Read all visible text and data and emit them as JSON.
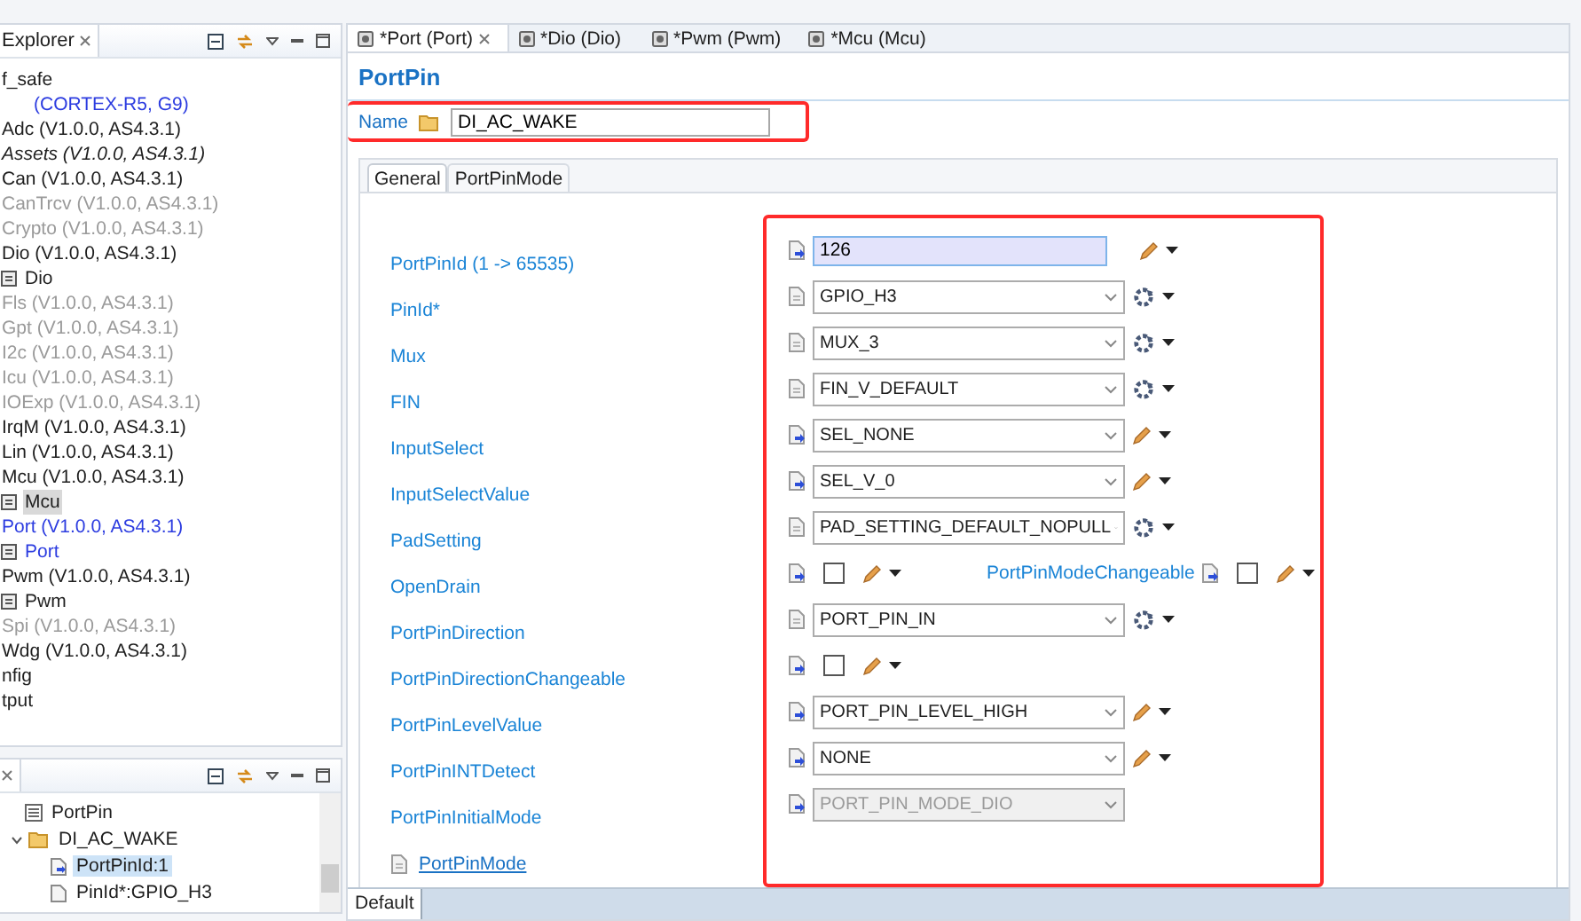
{
  "explorer": {
    "title": "Explorer",
    "items": [
      {
        "label": "f_safe",
        "kind": "module",
        "disabled": false,
        "italic": false,
        "color": "#1e1e1e",
        "selected": false
      },
      {
        "label": "(CORTEX-R5, G9)",
        "kind": "module",
        "disabled": false,
        "italic": false,
        "color": "#2c3ce0",
        "selected": false
      },
      {
        "label": "Adc (V1.0.0, AS4.3.1)",
        "kind": "module",
        "disabled": false,
        "italic": false,
        "color": "#1e1e1e",
        "selected": false
      },
      {
        "label": "Assets (V1.0.0, AS4.3.1)",
        "kind": "module",
        "disabled": false,
        "italic": true,
        "color": "#1e1e1e",
        "selected": false
      },
      {
        "label": "Can (V1.0.0, AS4.3.1)",
        "kind": "module",
        "disabled": false,
        "italic": false,
        "color": "#1e1e1e",
        "selected": false
      },
      {
        "label": "CanTrcv (V1.0.0, AS4.3.1)",
        "kind": "module",
        "disabled": true,
        "italic": false,
        "selected": false
      },
      {
        "label": "Crypto (V1.0.0, AS4.3.1)",
        "kind": "module",
        "disabled": true,
        "italic": false,
        "selected": false
      },
      {
        "label": "Dio (V1.0.0, AS4.3.1)",
        "kind": "module",
        "disabled": false,
        "italic": false,
        "color": "#1e1e1e",
        "selected": false
      },
      {
        "label": "Dio",
        "kind": "config",
        "disabled": false,
        "italic": false,
        "color": "#1e1e1e",
        "selected": false
      },
      {
        "label": "Fls (V1.0.0, AS4.3.1)",
        "kind": "module",
        "disabled": true,
        "italic": false,
        "selected": false
      },
      {
        "label": "Gpt (V1.0.0, AS4.3.1)",
        "kind": "module",
        "disabled": true,
        "italic": false,
        "selected": false
      },
      {
        "label": "I2c (V1.0.0, AS4.3.1)",
        "kind": "module",
        "disabled": true,
        "italic": false,
        "selected": false
      },
      {
        "label": "Icu (V1.0.0, AS4.3.1)",
        "kind": "module",
        "disabled": true,
        "italic": false,
        "selected": false
      },
      {
        "label": "IOExp (V1.0.0, AS4.3.1)",
        "kind": "module",
        "disabled": true,
        "italic": false,
        "selected": false
      },
      {
        "label": "IrqM (V1.0.0, AS4.3.1)",
        "kind": "module",
        "disabled": false,
        "italic": false,
        "color": "#1e1e1e",
        "selected": false
      },
      {
        "label": "Lin (V1.0.0, AS4.3.1)",
        "kind": "module",
        "disabled": false,
        "italic": false,
        "color": "#1e1e1e",
        "selected": false
      },
      {
        "label": "Mcu (V1.0.0, AS4.3.1)",
        "kind": "module",
        "disabled": false,
        "italic": false,
        "color": "#1e1e1e",
        "selected": false
      },
      {
        "label": "Mcu",
        "kind": "config",
        "disabled": false,
        "italic": false,
        "color": "#1e1e1e",
        "selected": true
      },
      {
        "label": "Port (V1.0.0, AS4.3.1)",
        "kind": "module",
        "disabled": false,
        "italic": false,
        "color": "#2c3ce0",
        "selected": false
      },
      {
        "label": "Port",
        "kind": "config",
        "disabled": false,
        "italic": false,
        "color": "#2c3ce0",
        "selected": false
      },
      {
        "label": "Pwm (V1.0.0, AS4.3.1)",
        "kind": "module",
        "disabled": false,
        "italic": false,
        "color": "#1e1e1e",
        "selected": false
      },
      {
        "label": "Pwm",
        "kind": "config",
        "disabled": false,
        "italic": false,
        "color": "#1e1e1e",
        "selected": false
      },
      {
        "label": "Spi (V1.0.0, AS4.3.1)",
        "kind": "module",
        "disabled": true,
        "italic": false,
        "selected": false
      },
      {
        "label": "Wdg (V1.0.0, AS4.3.1)",
        "kind": "module",
        "disabled": false,
        "italic": false,
        "color": "#1e1e1e",
        "selected": false
      },
      {
        "label": "nfig",
        "kind": "module",
        "disabled": false,
        "italic": false,
        "color": "#1e1e1e",
        "selected": false
      },
      {
        "label": "tput",
        "kind": "module",
        "disabled": false,
        "italic": false,
        "color": "#1e1e1e",
        "selected": false
      }
    ]
  },
  "outline": {
    "items": [
      {
        "label": "PortPin",
        "kind": "list",
        "selected": false
      },
      {
        "label": "DI_AC_WAKE",
        "kind": "folder",
        "selected": false,
        "expanded": true,
        "children": [
          {
            "label": "PortPinId:1",
            "selected": true
          },
          {
            "label": "PinId*:GPIO_H3",
            "selected": false
          }
        ]
      }
    ]
  },
  "editor_tabs": [
    {
      "label": "*Port (Port)",
      "selected": true
    },
    {
      "label": "*Dio (Dio)",
      "selected": false
    },
    {
      "label": "*Pwm (Pwm)",
      "selected": false
    },
    {
      "label": "*Mcu (Mcu)",
      "selected": false
    }
  ],
  "heading": "PortPin",
  "name": {
    "label": "Name",
    "value": "DI_AC_WAKE",
    "highlighted": true
  },
  "section_tabs": [
    {
      "label": "General",
      "selected": true
    },
    {
      "label": "PortPinMode",
      "selected": false
    }
  ],
  "params_highlighted": true,
  "params": [
    {
      "label": "PortPinId (1 -> 65535)",
      "kind": "text",
      "value": "126",
      "user_set": true,
      "calculated": false
    },
    {
      "label": "PinId*",
      "kind": "combo",
      "value": "GPIO_H3",
      "user_set": false,
      "calculated": true,
      "disabled": false
    },
    {
      "label": "Mux",
      "kind": "combo",
      "value": "MUX_3",
      "user_set": false,
      "calculated": true,
      "disabled": false
    },
    {
      "label": "FIN",
      "kind": "combo",
      "value": "FIN_V_DEFAULT",
      "user_set": false,
      "calculated": true,
      "disabled": false
    },
    {
      "label": "InputSelect",
      "kind": "combo",
      "value": "SEL_NONE",
      "user_set": true,
      "calculated": false,
      "disabled": false
    },
    {
      "label": "InputSelectValue",
      "kind": "combo",
      "value": "SEL_V_0",
      "user_set": true,
      "calculated": false,
      "disabled": false
    },
    {
      "label": "PadSetting",
      "kind": "combo",
      "value": "PAD_SETTING_DEFAULT_NOPULL",
      "user_set": false,
      "calculated": true,
      "disabled": false
    },
    {
      "label": "OpenDrain",
      "kind": "check",
      "checked": false,
      "user_set": true,
      "calculated": false,
      "extra": {
        "label": "PortPinModeChangeable",
        "checked": false
      }
    },
    {
      "label": "PortPinDirection",
      "kind": "combo",
      "value": "PORT_PIN_IN",
      "user_set": false,
      "calculated": true,
      "disabled": false
    },
    {
      "label": "PortPinDirectionChangeable",
      "kind": "check",
      "checked": false,
      "user_set": true,
      "calculated": false
    },
    {
      "label": "PortPinLevelValue",
      "kind": "combo",
      "value": "PORT_PIN_LEVEL_HIGH",
      "user_set": true,
      "calculated": false,
      "disabled": false
    },
    {
      "label": "PortPinINTDetect",
      "kind": "combo",
      "value": "NONE",
      "user_set": true,
      "calculated": false,
      "disabled": false
    },
    {
      "label": "PortPinInitialMode",
      "kind": "combo",
      "value": "PORT_PIN_MODE_DIO",
      "user_set": true,
      "disabled": true
    },
    {
      "label": "PortPinMode",
      "kind": "link",
      "user_set": false
    }
  ],
  "bottom_tabs": [
    {
      "label": "Default",
      "selected": true
    }
  ]
}
